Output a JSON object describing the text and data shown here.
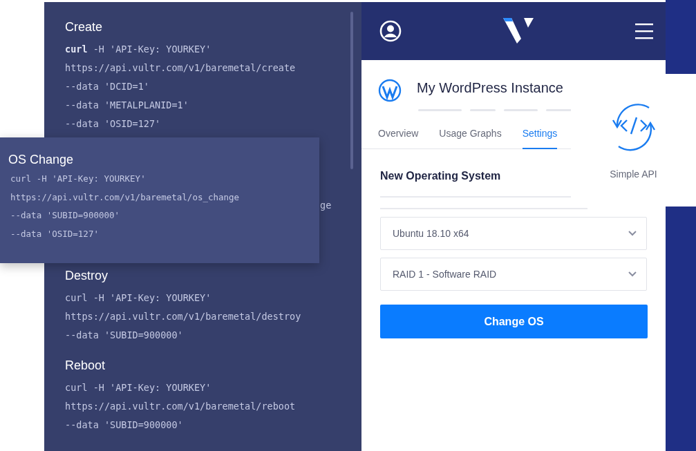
{
  "code_panel": {
    "sections": [
      {
        "title": "Create",
        "lines": [
          "**curl** -H 'API-Key: YOURKEY'",
          "https://api.vultr.com/v1/baremetal/create",
          "--data 'DCID=1'",
          "--data 'METALPLANID=1'",
          "--data 'OSID=127'"
        ]
      },
      {
        "title": "Destroy",
        "lines": [
          "curl -H 'API-Key: YOURKEY'",
          "https://api.vultr.com/v1/baremetal/destroy",
          "--data 'SUBID=900000'"
        ]
      },
      {
        "title": "Reboot",
        "lines": [
          "curl -H 'API-Key: YOURKEY'",
          "https://api.vultr.com/v1/baremetal/reboot",
          "--data 'SUBID=900000'"
        ]
      }
    ],
    "hidden_fragment": "ge"
  },
  "overlay_card": {
    "title": "OS Change",
    "lines": [
      "curl -H 'API-Key: YOURKEY'",
      "https://api.vultr.com/v1/baremetal/os_change",
      "--data 'SUBID=900000'",
      "--data 'OSID=127'"
    ]
  },
  "app": {
    "instance_title": "My WordPress Instance",
    "tabs": [
      {
        "label": "Overview",
        "selected": false
      },
      {
        "label": "Usage Graphs",
        "selected": false
      },
      {
        "label": "Settings",
        "selected": true
      }
    ],
    "section_title": "New Operating System",
    "selects": [
      {
        "value": "Ubuntu 18.10 x64"
      },
      {
        "value": "RAID 1 - Software RAID"
      }
    ],
    "button": "Change OS"
  },
  "feature_card": {
    "label": "Simple API"
  }
}
